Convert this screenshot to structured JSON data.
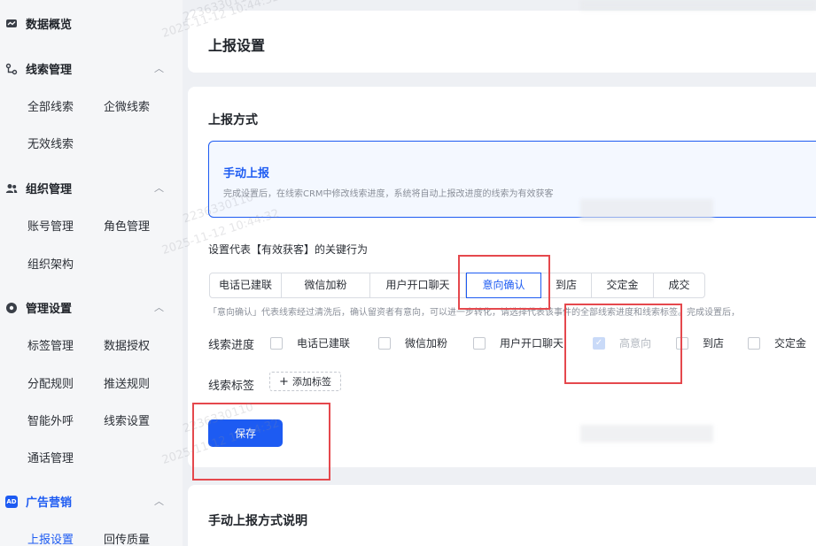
{
  "sidebar": {
    "groups": [
      {
        "icon": "chart-icon",
        "label": "数据概览"
      },
      {
        "icon": "branch-icon",
        "label": "线索管理",
        "items": [
          "全部线索",
          "企微线索",
          "无效线索"
        ]
      },
      {
        "icon": "users-icon",
        "label": "组织管理",
        "items": [
          "账号管理",
          "角色管理",
          "组织架构"
        ]
      },
      {
        "icon": "settings-icon",
        "label": "管理设置",
        "items": [
          "标签管理",
          "数据授权",
          "分配规则",
          "推送规则",
          "智能外呼",
          "线索设置",
          "通话管理"
        ]
      },
      {
        "icon": "ad-icon",
        "icon_text": "AD",
        "label": "广告营销",
        "items": [
          "上报设置",
          "回传质量"
        ]
      }
    ],
    "active_item": "上报设置"
  },
  "header": {
    "title": "上报设置"
  },
  "report": {
    "section_title": "上报方式",
    "method": {
      "name": "手动上报",
      "desc": "完成设置后，在线索CRM中修改线索进度，系统将自动上报改进度的线索为有效获客"
    },
    "key_action_label": "设置代表【有效获客】的关键行为",
    "actions": [
      "电话已建联",
      "微信加粉",
      "用户开口聊天",
      "意向确认",
      "到店",
      "交定金",
      "成交"
    ],
    "active_action": "意向确认",
    "hint": "「意向确认」代表线索经过清洗后，确认留资者有意向，可以进一步转化，请选择代表该事件的全部线索进度和线索标签。完成设置后，",
    "progress_label": "线索进度",
    "progress_options": [
      {
        "label": "电话已建联",
        "checked": false
      },
      {
        "label": "微信加粉",
        "checked": false
      },
      {
        "label": "用户开口聊天",
        "checked": false
      },
      {
        "label": "高意向",
        "checked": true
      },
      {
        "label": "到店",
        "checked": false
      },
      {
        "label": "交定金",
        "checked": false
      }
    ],
    "tag_label": "线索标签",
    "add_tag": "添加标签",
    "save": "保存"
  },
  "explain": {
    "title": "手动上报方式说明"
  },
  "watermark": {
    "id": "2236330110",
    "time": "2025-11-12 10:44:32"
  },
  "colors": {
    "primary": "#1d5bf2",
    "annotation": "#e5484d"
  }
}
